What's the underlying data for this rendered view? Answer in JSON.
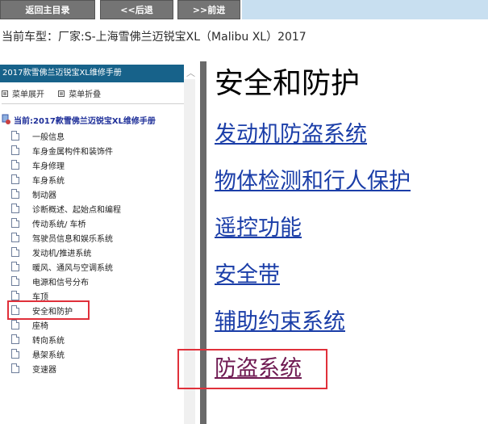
{
  "toolbar": {
    "back_home_label": "返回主目录",
    "back_label": "<<后退",
    "forward_label": ">>前进"
  },
  "vehicle_banner": "当前车型：厂家:S-上海雪佛兰迈锐宝XL（Malibu XL）2017",
  "sidebar": {
    "header": "2017款雪佛兰迈锐宝XL维修手册",
    "expand_label": "菜单展开",
    "collapse_label": "菜单折叠",
    "current_label": "当前:2017款雪佛兰迈锐宝XL维修手册",
    "items": [
      {
        "label": "一般信息"
      },
      {
        "label": "车身金属构件和装饰件"
      },
      {
        "label": "车身修理"
      },
      {
        "label": "车身系统"
      },
      {
        "label": "制动器"
      },
      {
        "label": "诊断概述、起始点和编程"
      },
      {
        "label": "传动系统/ 车桥"
      },
      {
        "label": "驾驶员信息和娱乐系统"
      },
      {
        "label": "发动机/推进系统"
      },
      {
        "label": "暖风、通风与空调系统"
      },
      {
        "label": "电源和信号分布"
      },
      {
        "label": "车顶"
      },
      {
        "label": "安全和防护",
        "active": true
      },
      {
        "label": "座椅"
      },
      {
        "label": "转向系统"
      },
      {
        "label": "悬架系统"
      },
      {
        "label": "变速器"
      }
    ]
  },
  "main": {
    "title": "安全和防护",
    "links": [
      {
        "label": "发动机防盗系统"
      },
      {
        "label": "物体检测和行人保护"
      },
      {
        "label": "遥控功能"
      },
      {
        "label": "安全带"
      },
      {
        "label": "辅助约束系统"
      },
      {
        "label": "防盗系统",
        "visited": true
      }
    ]
  },
  "colors": {
    "toolbar_button": "#747474",
    "sidebar_header": "#17628a",
    "link": "#1b3ea8",
    "visited_link": "#6f1a52",
    "highlight": "#e0303a"
  }
}
